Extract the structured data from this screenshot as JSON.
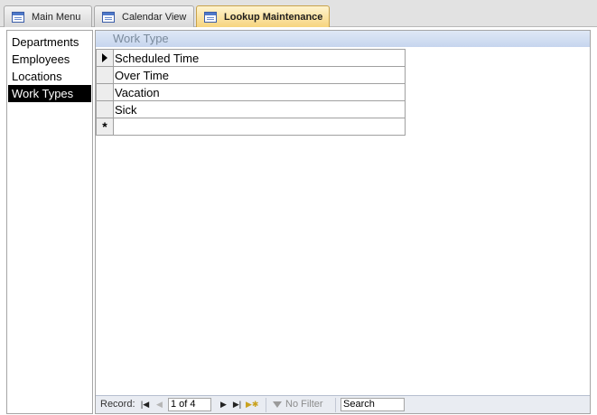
{
  "tabs": [
    {
      "label": "Main Menu",
      "icon": "form-icon",
      "active": false
    },
    {
      "label": "Calendar View",
      "icon": "form-icon",
      "active": false
    },
    {
      "label": "Lookup Maintenance",
      "icon": "form-icon",
      "active": true
    }
  ],
  "lookup_list": {
    "items": [
      "Departments",
      "Employees",
      "Locations",
      "Work Types"
    ],
    "selected": "Work Types"
  },
  "subform": {
    "column_header": "Work Type",
    "rows": [
      "Scheduled Time",
      "Over Time",
      "Vacation",
      "Sick"
    ],
    "current_row_marker": "arrow-icon",
    "new_row_marker": "*"
  },
  "navigation": {
    "record_label": "Record:",
    "record_position": "1 of 4",
    "filter_label": "No Filter",
    "search_value": "Search",
    "first_icon": "first-record-icon",
    "previous_icon": "previous-record-icon",
    "next_icon": "next-record-icon",
    "last_icon": "last-record-icon",
    "new_icon": "new-record-icon",
    "filter_icon": "filter-icon"
  },
  "colors": {
    "active_tab": "#f6d37a",
    "selection": "#000000",
    "header": "#c6d5ee"
  }
}
